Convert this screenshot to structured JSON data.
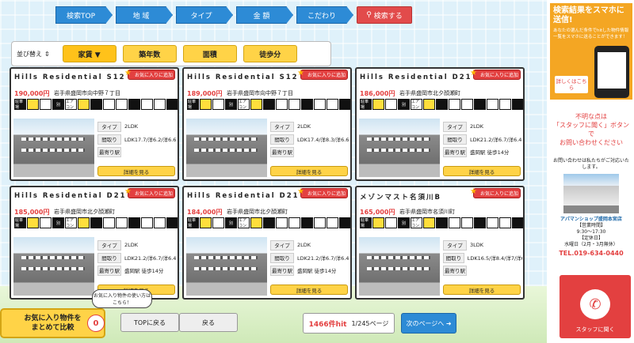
{
  "steps": [
    "検索TOP",
    "地 域",
    "タイプ",
    "金 額",
    "こだわり",
    "検索する"
  ],
  "search_icon": "search-icon",
  "sort": {
    "label": "並び替え",
    "buttons": [
      "家賃 ▼",
      "築年数",
      "面積",
      "徒歩分"
    ]
  },
  "fav_label": "お気に入りに追加",
  "detail_label": "詳細を見る",
  "row_keys": [
    "タイプ",
    "間取り",
    "最寄り駅"
  ],
  "cards": [
    {
      "title": "Hills Residential S12",
      "price": "190,000円",
      "addr": "岩手県盛岡市向中野７丁目",
      "type": "2LDK",
      "layout": "LDK17.7/洋6.2/洋6.6",
      "station": ""
    },
    {
      "title": "Hills Residential S12",
      "price": "189,000円",
      "addr": "岩手県盛岡市向中野７丁目",
      "type": "2LDK",
      "layout": "LDK17.4/洋8.3/洋6.6",
      "station": ""
    },
    {
      "title": "Hills Residential D21",
      "price": "186,000円",
      "addr": "岩手県盛岡市北夕顔瀬町",
      "type": "2LDK",
      "layout": "LDK21.2/洋6.7/洋6.4",
      "station": "盛岡駅 徒歩14分"
    },
    {
      "title": "Hills Residential D21",
      "price": "185,000円",
      "addr": "岩手県盛岡市北夕顔瀬町",
      "type": "2LDK",
      "layout": "LDK21.2/洋6.7/洋6.4",
      "station": "盛岡駅 徒歩14分"
    },
    {
      "title": "Hills Residential D21",
      "price": "184,000円",
      "addr": "岩手県盛岡市北夕顔瀬町",
      "type": "2LDK",
      "layout": "LDK21.2/洋6.7/洋6.4",
      "station": "盛岡駅 徒歩14分"
    },
    {
      "title": "メゾンマスト名須川B",
      "price": "165,000円",
      "addr": "岩手県盛岡市名須川町",
      "type": "3LDK",
      "layout": "LDK16.5/洋8.4/洋7/洋6.5",
      "station": ""
    }
  ],
  "icon_labels": [
    "駐車場",
    "",
    "",
    "別",
    "エアコン",
    "",
    "",
    "",
    "",
    "",
    "",
    "",
    ""
  ],
  "bottom": {
    "fav_line1": "お気に入り物件を",
    "fav_line2": "まとめて比較",
    "fav_count": "0",
    "bubble": "お気に入り物件の使い方はこちら！",
    "top_btn": "TOPに戻る",
    "back_btn": "戻る",
    "hit_count": "1466件hit",
    "page": "1/245ページ",
    "next_btn": "次のページへ"
  },
  "side": {
    "ad_title": "検索結果をスマホに送信!",
    "ad_text": "あなたの選んだ条件でhitした物件情報一覧をスマホに送ることができます！",
    "ad_more": "詳しくはこちら",
    "inq1": "不明な点は",
    "inq2": "「スタッフに聞く」ボタンで",
    "inq3": "お問い合わせください",
    "shop_caption": "お問い合わせは私たちがご対応いたします。",
    "shop_name": "アパマンショップ盛岡本宮店",
    "hours_label": "【営業時間】",
    "hours": "9:30～17:30",
    "closed_label": "【定休日】",
    "closed": "水曜日（2月・3月無休）",
    "tel": "TEL.019-634-0440",
    "call_btn": "スタッフに聞く"
  }
}
